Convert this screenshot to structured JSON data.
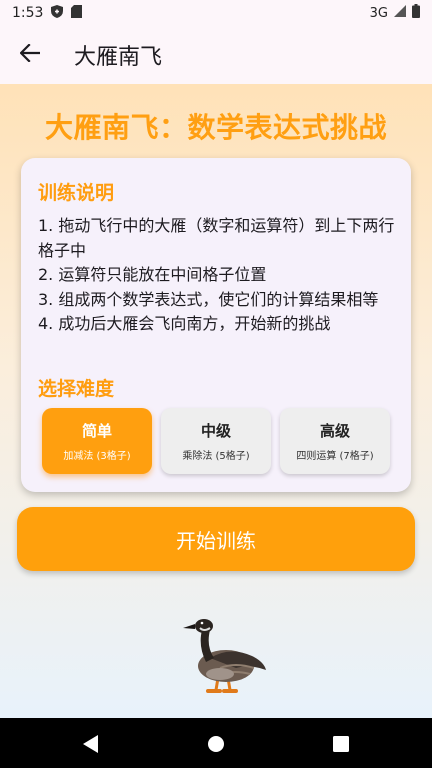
{
  "status_bar": {
    "time": "1:53",
    "network": "3G",
    "icons": [
      "shield-icon",
      "sd-card-icon",
      "signal-icon",
      "battery-icon"
    ]
  },
  "app_bar": {
    "back_icon": "arrow-back-icon",
    "title": "大雁南飞"
  },
  "hero": {
    "title": "大雁南飞：数学表达式挑战"
  },
  "instructions": {
    "title": "训练说明",
    "lines": [
      "1. 拖动飞行中的大雁（数字和运算符）到上下两行格子中",
      "2. 运算符只能放在中间格子位置",
      "3. 组成两个数学表达式，使它们的计算结果相等",
      "4. 成功后大雁会飞向南方，开始新的挑战"
    ]
  },
  "difficulty": {
    "title": "选择难度",
    "options": [
      {
        "label": "简单",
        "sub": "加减法 (3格子)",
        "selected": true
      },
      {
        "label": "中级",
        "sub": "乘除法 (5格子)",
        "selected": false
      },
      {
        "label": "高级",
        "sub": "四则运算 (7格子)",
        "selected": false
      }
    ]
  },
  "start_button": {
    "label": "开始训练"
  },
  "nav_bar": {
    "icons": [
      "back-triangle-icon",
      "home-circle-icon",
      "recents-square-icon"
    ]
  },
  "colors": {
    "accent": "#ff9f12",
    "button": "#ffa00c",
    "card": "#f6f1fb"
  }
}
